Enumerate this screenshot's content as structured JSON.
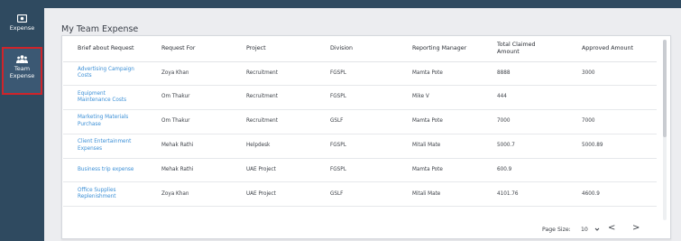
{
  "sidebar": {
    "items": [
      {
        "label": "Expense",
        "icon": "money-icon"
      },
      {
        "label": "Team\nExpense",
        "icon": "team-icon",
        "active": true
      }
    ]
  },
  "page": {
    "title": "My Team Expense"
  },
  "table": {
    "columns": [
      "Brief about Request",
      "Request For",
      "Project",
      "Division",
      "Reporting Manager",
      "Total Claimed\nAmount",
      "Approved Amount"
    ],
    "rows": [
      [
        "Advertising Campaign\nCosts",
        "Zoya Khan",
        "Recruitment",
        "FGSPL",
        "Mamta Pote",
        "8888",
        "3000"
      ],
      [
        "Equipment\nMaintenance Costs",
        "Om Thakur",
        "Recruitment",
        "FGSPL",
        "Mike V",
        "444",
        ""
      ],
      [
        "Marketing Materials\nPurchase",
        "Om Thakur",
        "Recruitment",
        "GSLF",
        "Mamta Pote",
        "7000",
        "7000"
      ],
      [
        "Client Entertainment\nExpenses",
        "Mehak Rathi",
        "Helpdesk",
        "FGSPL",
        "Mitali Mate",
        "5000.7",
        "5000.89"
      ],
      [
        "Business trip expense",
        "Mehak Rathi",
        "UAE Project",
        "FGSPL",
        "Mamta Pote",
        "600.9",
        ""
      ],
      [
        "Office Supplies\nReplenishment",
        "Zoya Khan",
        "UAE Project",
        "GSLF",
        "Mitali Mate",
        "4101.76",
        "4600.9"
      ]
    ]
  },
  "pager": {
    "label": "Page Size:",
    "size": "10",
    "prev": "<",
    "next": ">"
  },
  "colors": {
    "sidebar": "#2f4a60",
    "link": "#3b8fd6",
    "highlight": "#d0242a"
  }
}
